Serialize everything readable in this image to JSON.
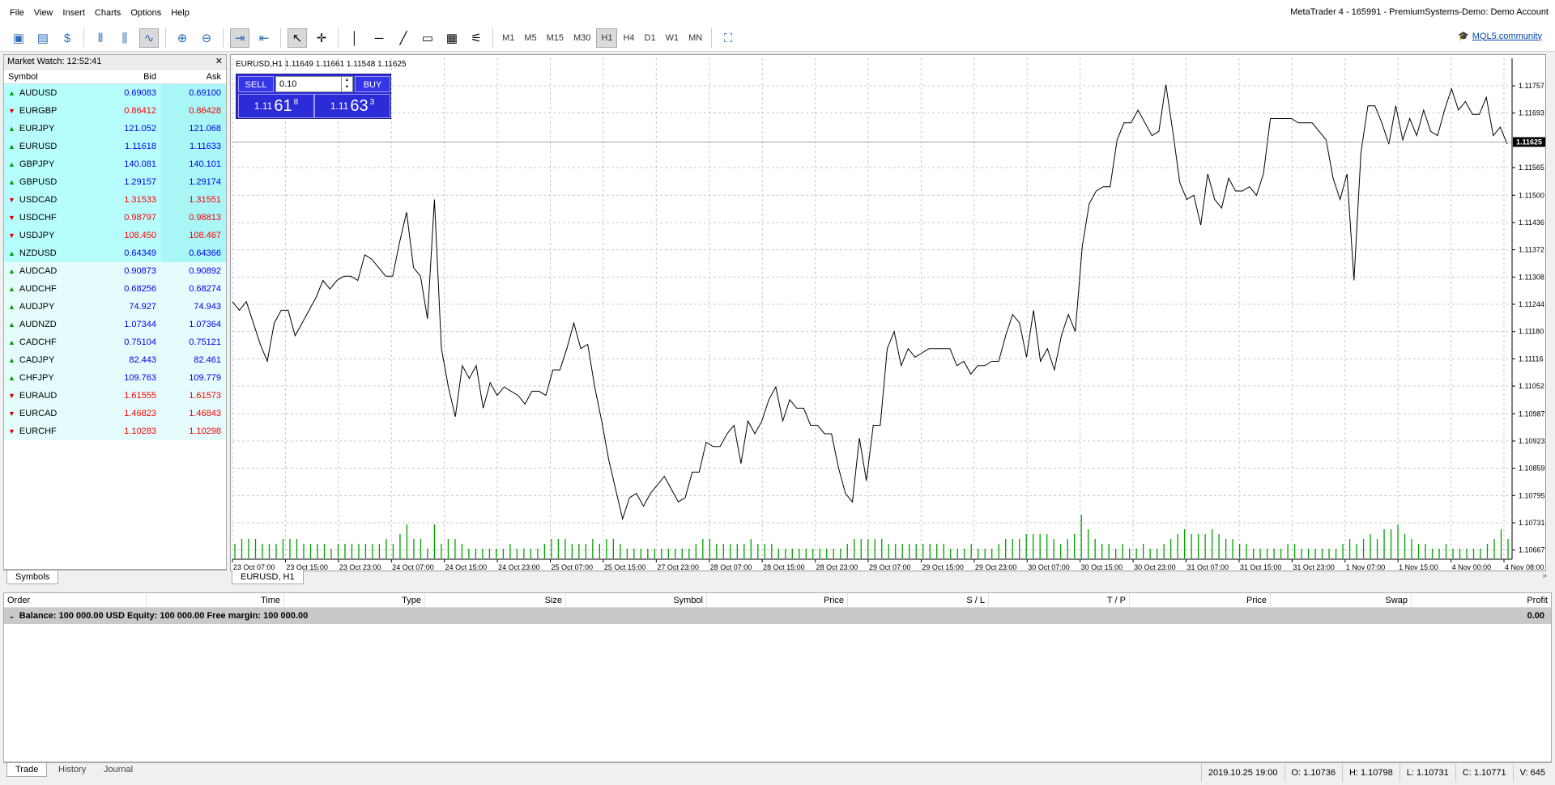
{
  "menu": [
    "File",
    "View",
    "Insert",
    "Charts",
    "Options",
    "Help"
  ],
  "window_title": "MetaTrader 4 - 165991 - PremiumSystems-Demo: Demo Account",
  "toolbar": {
    "timeframes": [
      "M1",
      "M5",
      "M15",
      "M30",
      "H1",
      "H4",
      "D1",
      "W1",
      "MN"
    ],
    "active_timeframe": "H1"
  },
  "mql": "MQL5.community",
  "market_watch": {
    "title": "Market Watch: 12:52:41",
    "cols": {
      "symbol": "Symbol",
      "bid": "Bid",
      "ask": "Ask"
    },
    "rows": [
      {
        "symbol": "AUDUSD",
        "bid": "0.69083",
        "ask": "0.69100",
        "dir": "up",
        "hl": true
      },
      {
        "symbol": "EURGBP",
        "bid": "0.86412",
        "ask": "0.86428",
        "dir": "dn",
        "hl": true
      },
      {
        "symbol": "EURJPY",
        "bid": "121.052",
        "ask": "121.068",
        "dir": "up",
        "hl": true
      },
      {
        "symbol": "EURUSD",
        "bid": "1.11618",
        "ask": "1.11633",
        "dir": "up",
        "hl": true
      },
      {
        "symbol": "GBPJPY",
        "bid": "140.081",
        "ask": "140.101",
        "dir": "up",
        "hl": true
      },
      {
        "symbol": "GBPUSD",
        "bid": "1.29157",
        "ask": "1.29174",
        "dir": "up",
        "hl": true
      },
      {
        "symbol": "USDCAD",
        "bid": "1.31533",
        "ask": "1.31551",
        "dir": "dn",
        "hl": true
      },
      {
        "symbol": "USDCHF",
        "bid": "0.98797",
        "ask": "0.98813",
        "dir": "dn",
        "hl": true
      },
      {
        "symbol": "USDJPY",
        "bid": "108.450",
        "ask": "108.467",
        "dir": "dn",
        "hl": true
      },
      {
        "symbol": "NZDUSD",
        "bid": "0.64349",
        "ask": "0.64366",
        "dir": "up",
        "hl": true
      },
      {
        "symbol": "AUDCAD",
        "bid": "0.90873",
        "ask": "0.90892",
        "dir": "up",
        "hl": false
      },
      {
        "symbol": "AUDCHF",
        "bid": "0.68256",
        "ask": "0.68274",
        "dir": "up",
        "hl": false
      },
      {
        "symbol": "AUDJPY",
        "bid": "74.927",
        "ask": "74.943",
        "dir": "up",
        "hl": false
      },
      {
        "symbol": "AUDNZD",
        "bid": "1.07344",
        "ask": "1.07364",
        "dir": "up",
        "hl": false
      },
      {
        "symbol": "CADCHF",
        "bid": "0.75104",
        "ask": "0.75121",
        "dir": "up",
        "hl": false
      },
      {
        "symbol": "CADJPY",
        "bid": "82.443",
        "ask": "82.461",
        "dir": "up",
        "hl": false
      },
      {
        "symbol": "CHFJPY",
        "bid": "109.763",
        "ask": "109.779",
        "dir": "up",
        "hl": false
      },
      {
        "symbol": "EURAUD",
        "bid": "1.61555",
        "ask": "1.61573",
        "dir": "dn",
        "hl": false
      },
      {
        "symbol": "EURCAD",
        "bid": "1.46823",
        "ask": "1.46843",
        "dir": "dn",
        "hl": false
      },
      {
        "symbol": "EURCHF",
        "bid": "1.10283",
        "ask": "1.10298",
        "dir": "dn",
        "hl": false
      }
    ],
    "tab": "Symbols"
  },
  "chart": {
    "info": "EURUSD,H1  1.11649 1.11661 1.11548 1.11625",
    "tab": "EURUSD, H1",
    "one_click": {
      "sell": "SELL",
      "buy": "BUY",
      "lot": "0.10",
      "sell_big": "1.11",
      "sell_main": "61",
      "sell_sup": "8",
      "buy_big": "1.11",
      "buy_main": "63",
      "buy_sup": "3"
    }
  },
  "chart_data": {
    "type": "line",
    "current_price": "1.11625",
    "y_ticks": [
      "1.11757",
      "1.11693",
      "1.11565",
      "1.11500",
      "1.11436",
      "1.11372",
      "1.11308",
      "1.11244",
      "1.11180",
      "1.11116",
      "1.11052",
      "1.10987",
      "1.10923",
      "1.10859",
      "1.10795",
      "1.10731",
      "1.10667"
    ],
    "x_ticks": [
      "23 Oct 07:00",
      "23 Oct 15:00",
      "23 Oct 23:00",
      "24 Oct 07:00",
      "24 Oct 15:00",
      "24 Oct 23:00",
      "25 Oct 07:00",
      "25 Oct 15:00",
      "27 Oct 23:00",
      "28 Oct 07:00",
      "28 Oct 15:00",
      "28 Oct 23:00",
      "29 Oct 07:00",
      "29 Oct 15:00",
      "29 Oct 23:00",
      "30 Oct 07:00",
      "30 Oct 15:00",
      "30 Oct 23:00",
      "31 Oct 07:00",
      "31 Oct 15:00",
      "31 Oct 23:00",
      "1 Nov 07:00",
      "1 Nov 15:00",
      "4 Nov 00:00",
      "4 Nov 08:00"
    ],
    "values": [
      1.1125,
      1.1123,
      1.1125,
      1.112,
      1.1115,
      1.1111,
      1.112,
      1.1123,
      1.1123,
      1.1117,
      1.112,
      1.1123,
      1.1126,
      1.113,
      1.1128,
      1.113,
      1.1131,
      1.1131,
      1.113,
      1.1136,
      1.1135,
      1.1133,
      1.1131,
      1.1131,
      1.1139,
      1.1146,
      1.1133,
      1.1131,
      1.1121,
      1.1149,
      1.1114,
      1.1105,
      1.1098,
      1.111,
      1.1107,
      1.111,
      1.11,
      1.1106,
      1.1103,
      1.1105,
      1.1104,
      1.1103,
      1.1101,
      1.1104,
      1.1104,
      1.1103,
      1.1109,
      1.1109,
      1.1114,
      1.112,
      1.1114,
      1.1115,
      1.1105,
      1.1097,
      1.1088,
      1.1081,
      1.1074,
      1.1079,
      1.108,
      1.1077,
      1.108,
      1.1082,
      1.1084,
      1.1081,
      1.1078,
      1.1079,
      1.1085,
      1.1085,
      1.1092,
      1.1091,
      1.1091,
      1.1094,
      1.1096,
      1.1087,
      1.1097,
      1.1094,
      1.1097,
      1.1102,
      1.1105,
      1.1097,
      1.1102,
      1.11,
      1.11,
      1.1096,
      1.1096,
      1.1094,
      1.1094,
      1.1086,
      1.108,
      1.1078,
      1.1093,
      1.1083,
      1.1096,
      1.1096,
      1.1114,
      1.1118,
      1.111,
      1.1114,
      1.1112,
      1.1113,
      1.1114,
      1.1114,
      1.1114,
      1.1114,
      1.111,
      1.1111,
      1.1108,
      1.111,
      1.111,
      1.1111,
      1.1111,
      1.1117,
      1.1122,
      1.112,
      1.1112,
      1.1123,
      1.1111,
      1.1114,
      1.1109,
      1.1117,
      1.1122,
      1.1118,
      1.1138,
      1.1148,
      1.1151,
      1.1152,
      1.1152,
      1.1163,
      1.1167,
      1.1167,
      1.117,
      1.1167,
      1.1164,
      1.1165,
      1.1176,
      1.1165,
      1.1153,
      1.1149,
      1.115,
      1.1143,
      1.1155,
      1.1149,
      1.1147,
      1.1154,
      1.1151,
      1.1151,
      1.1152,
      1.115,
      1.1155,
      1.1168,
      1.1168,
      1.1168,
      1.1168,
      1.1167,
      1.1167,
      1.1167,
      1.1165,
      1.1163,
      1.1154,
      1.1149,
      1.1155,
      1.113,
      1.116,
      1.1171,
      1.1171,
      1.1167,
      1.1162,
      1.1171,
      1.1163,
      1.1168,
      1.1164,
      1.117,
      1.1165,
      1.1164,
      1.117,
      1.1175,
      1.117,
      1.1172,
      1.1169,
      1.1169,
      1.1173,
      1.1164,
      1.1166,
      1.1162
    ],
    "volume": [
      3,
      4,
      4,
      4,
      3,
      3,
      3,
      4,
      4,
      4,
      3,
      3,
      3,
      3,
      2,
      3,
      3,
      3,
      3,
      3,
      3,
      3,
      4,
      3,
      5,
      7,
      4,
      4,
      2,
      7,
      3,
      4,
      4,
      3,
      2,
      2,
      2,
      2,
      2,
      2,
      3,
      2,
      2,
      2,
      2,
      3,
      4,
      4,
      4,
      3,
      3,
      3,
      4,
      3,
      4,
      4,
      3,
      2,
      2,
      2,
      2,
      2,
      2,
      2,
      2,
      2,
      2,
      3,
      4,
      4,
      3,
      3,
      3,
      3,
      3,
      4,
      3,
      3,
      3,
      2,
      2,
      2,
      2,
      2,
      2,
      2,
      2,
      2,
      2,
      3,
      4,
      4,
      4,
      4,
      4,
      3,
      3,
      3,
      3,
      3,
      3,
      3,
      3,
      3,
      2,
      2,
      2,
      3,
      2,
      2,
      2,
      3,
      4,
      4,
      4,
      5,
      5,
      5,
      5,
      4,
      3,
      4,
      5,
      9,
      6,
      4,
      3,
      3,
      2,
      3,
      2,
      2,
      3,
      2,
      2,
      3,
      4,
      5,
      6,
      5,
      5,
      5,
      6,
      5,
      4,
      4,
      3,
      3,
      2,
      2,
      2,
      2,
      2,
      3,
      3,
      2,
      2,
      2,
      2,
      2,
      2,
      3,
      4,
      3,
      4,
      5,
      4,
      6,
      6,
      7,
      5,
      4,
      3,
      3,
      2,
      2,
      3,
      2,
      2,
      2,
      2,
      2,
      3,
      4,
      6,
      4
    ]
  },
  "terminal": {
    "cols": [
      "Order",
      "Time",
      "Type",
      "Size",
      "Symbol",
      "Price",
      "S / L",
      "T / P",
      "Price",
      "Swap",
      "Profit"
    ],
    "balance": "Balance: 100 000.00 USD  Equity: 100 000.00  Free margin: 100 000.00",
    "profit": "0.00",
    "tabs": [
      "Trade",
      "History",
      "Journal"
    ]
  },
  "status": {
    "date": "2019.10.25 19:00",
    "open": "O: 1.10736",
    "high": "H: 1.10798",
    "low": "L: 1.10731",
    "close": "C: 1.10771",
    "vol": "V: 645"
  }
}
